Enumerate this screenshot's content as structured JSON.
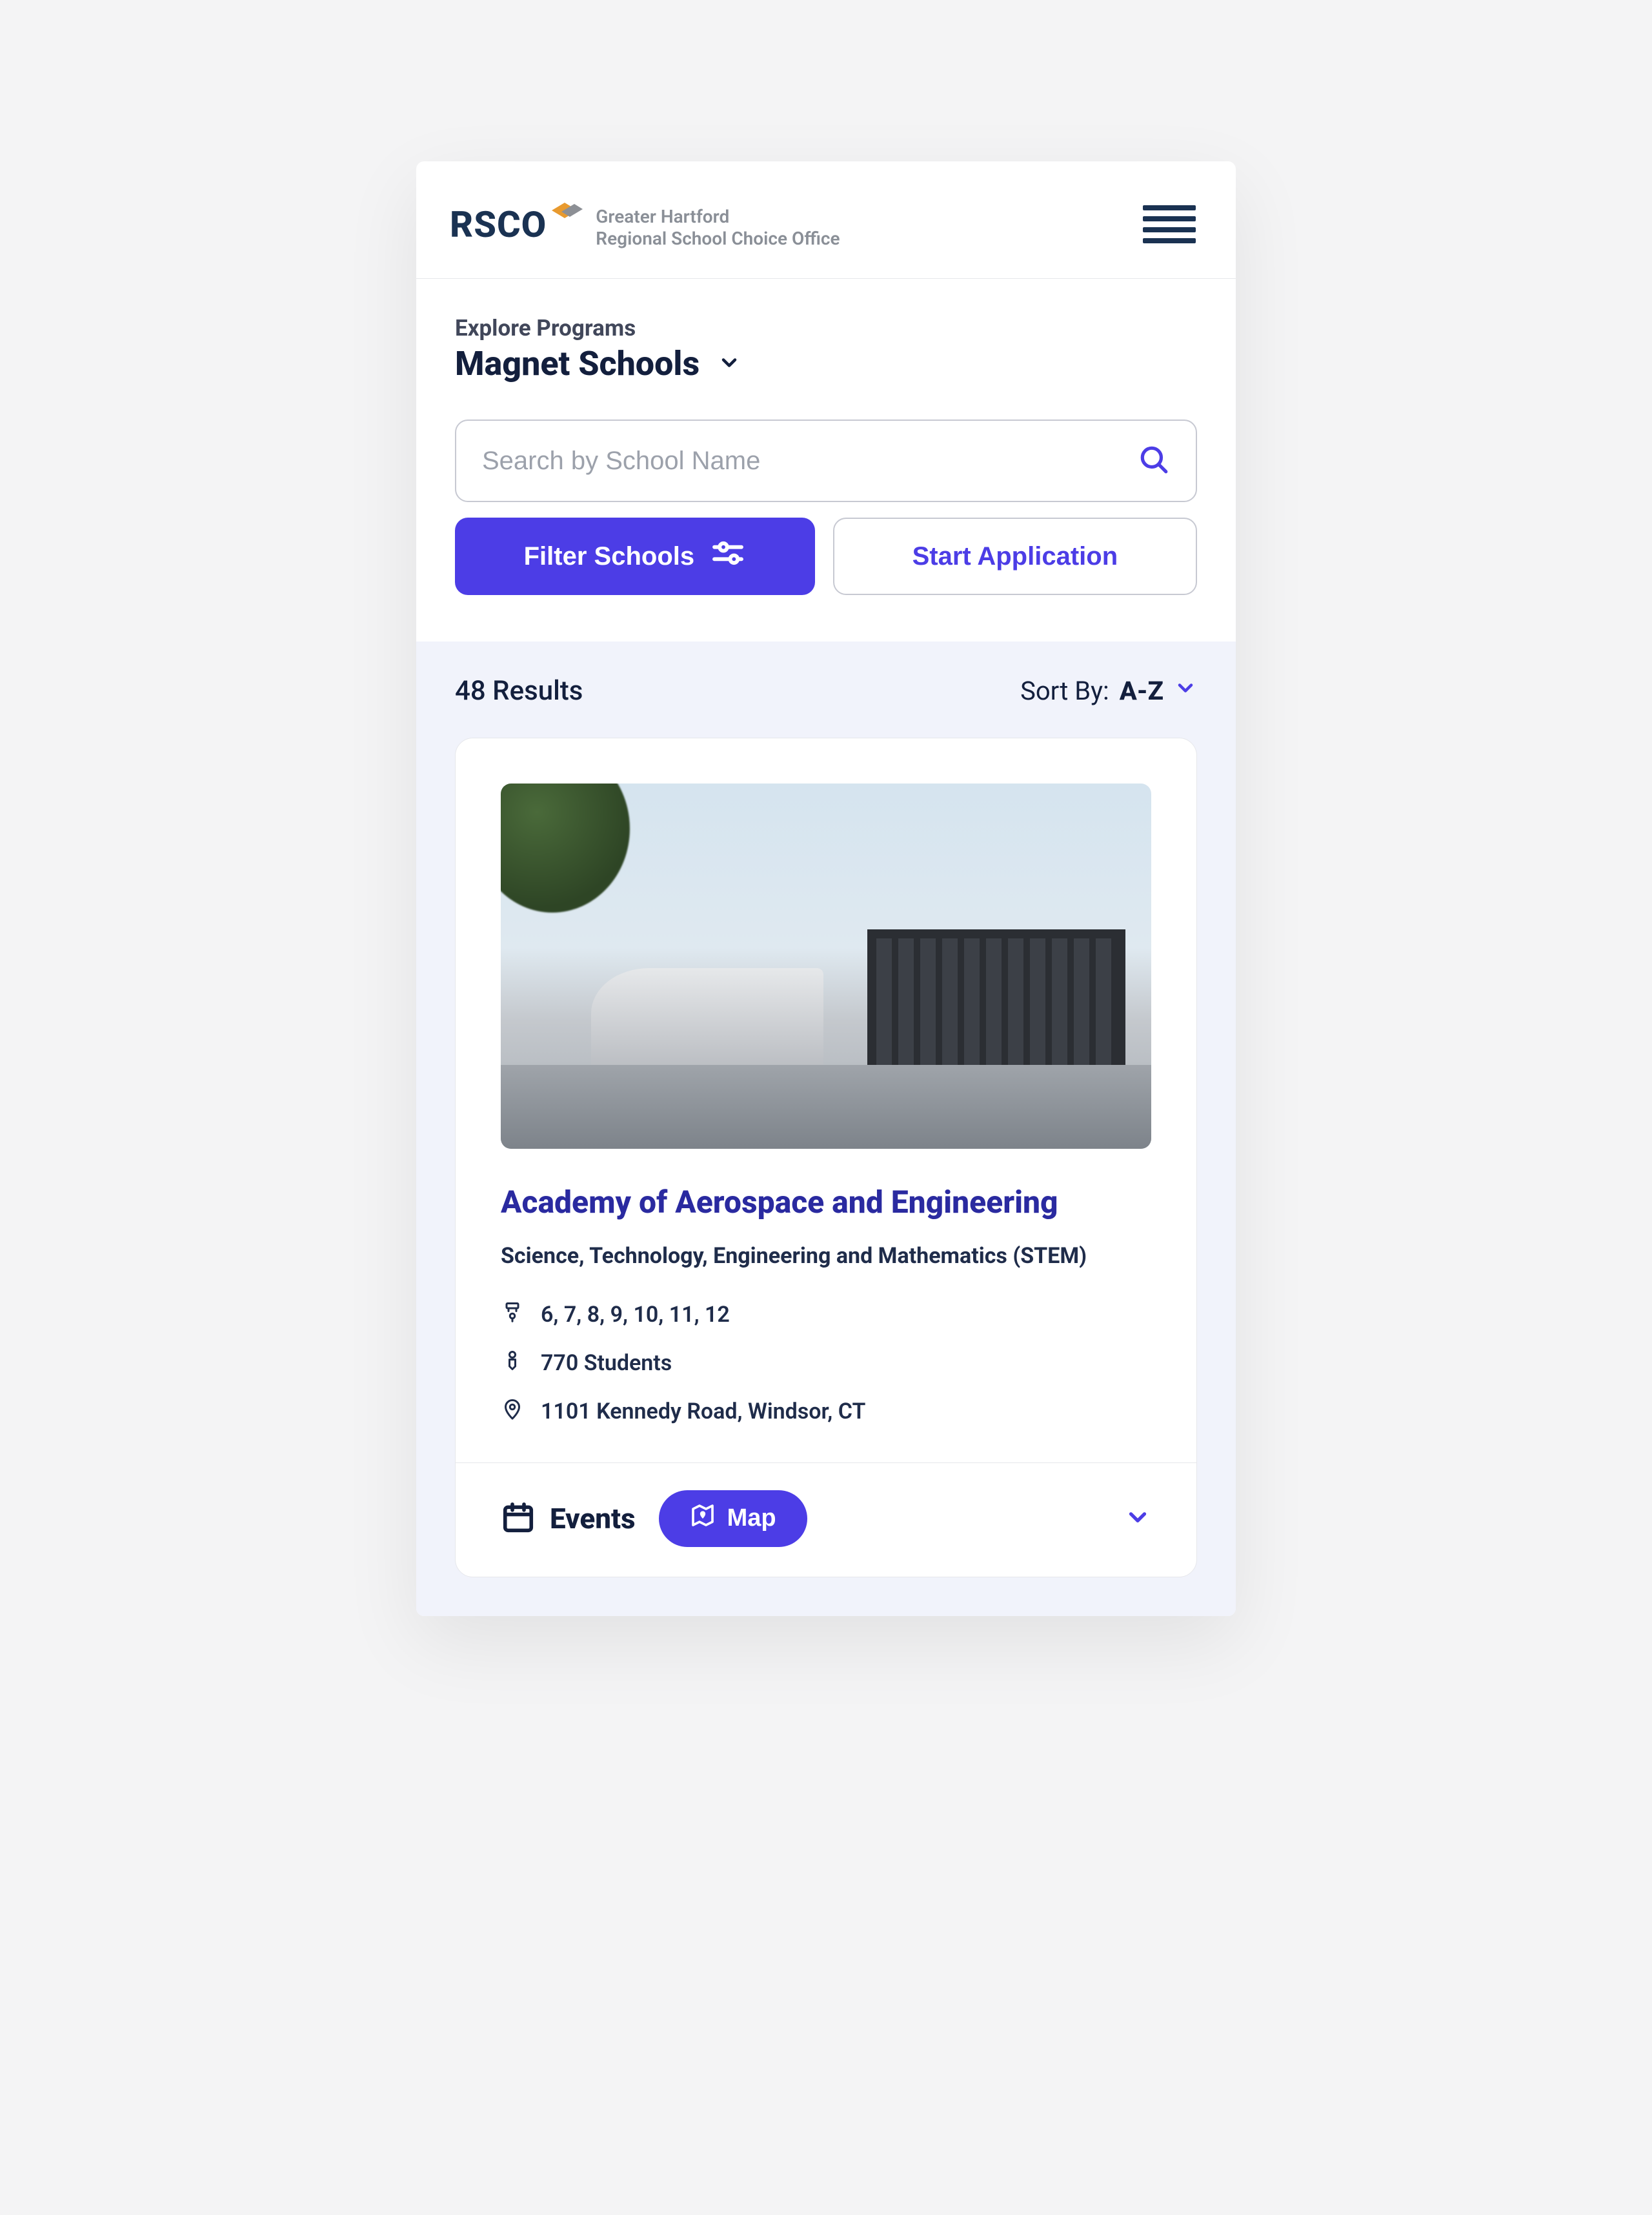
{
  "logo": {
    "name": "RSCO",
    "sub1": "Greater Hartford",
    "sub2": "Regional School Choice Office"
  },
  "explore": {
    "label": "Explore Programs",
    "title": "Magnet Schools"
  },
  "search": {
    "placeholder": "Search by School Name"
  },
  "actions": {
    "filter": "Filter Schools",
    "start": "Start Application"
  },
  "results": {
    "count": "48 Results",
    "sort_label": "Sort By:",
    "sort_value": "A-Z"
  },
  "card": {
    "title": "Academy of Aerospace and Engineering",
    "subtitle": "Science, Technology, Engineering and Mathematics (STEM)",
    "grades": "6, 7, 8, 9, 10, 11, 12",
    "students": "770 Students",
    "address": "1101 Kennedy Road, Windsor, CT"
  },
  "bottom": {
    "events": "Events",
    "map": "Map"
  }
}
